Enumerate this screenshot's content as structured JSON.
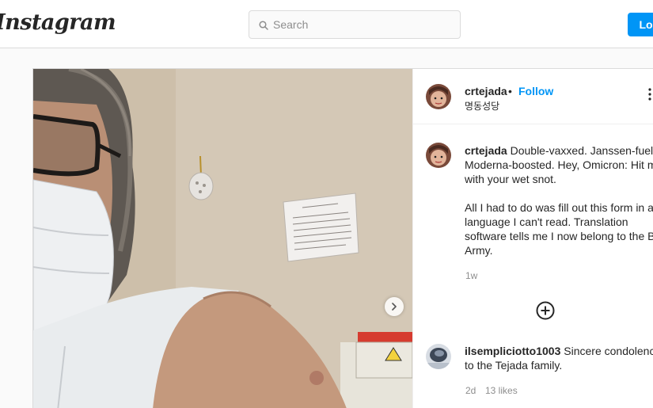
{
  "nav": {
    "logo": "Instagram",
    "search_placeholder": "Search",
    "login_label": "Log In"
  },
  "post": {
    "author": {
      "username": "crtejada",
      "follow_label": "Follow",
      "separator": "•",
      "location": "명동성당"
    },
    "caption": {
      "username": "crtejada",
      "paragraph1": "Double-vaxxed. Janssen-fueled. Moderna-boosted. Hey, Omicron: Hit me with your wet snot.",
      "paragraph2": "All I had to do was fill out this form in a language I can't read. Translation software tells me I now belong to the Blue Army.",
      "age": "1w"
    },
    "comments": [
      {
        "username": "ilsempliciotto1003",
        "text": "Sincere condolences to the Tejada family.",
        "age": "2d",
        "likes": "13 likes"
      }
    ]
  },
  "icons": {
    "search": "search-icon",
    "next": "chevron-right-icon",
    "more": "more-options-icon",
    "load_more": "plus-circle-icon"
  },
  "colors": {
    "accent": "#0095f6",
    "text": "#262626",
    "muted": "#8e8e8e",
    "border": "#dbdbdb"
  }
}
